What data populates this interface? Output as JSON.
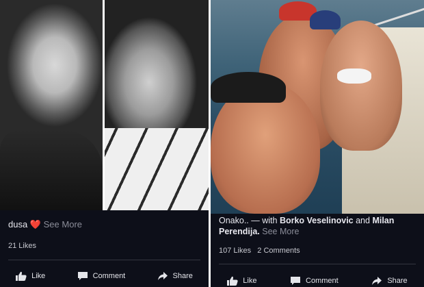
{
  "left_post": {
    "caption_text": "dusa",
    "caption_emoji": "❤️",
    "see_more": "See More",
    "likes": "21 Likes",
    "actions": {
      "like": "Like",
      "comment": "Comment",
      "share": "Share"
    }
  },
  "right_post": {
    "caption_prefix": "Onako.. — with",
    "tag1": "Borko Veselinovic",
    "and": "and",
    "tag2": "Milan Perendija.",
    "see_more": "See More",
    "likes": "107 Likes",
    "comments": "2 Comments",
    "actions": {
      "like": "Like",
      "comment": "Comment",
      "share": "Share"
    }
  },
  "colors": {
    "background": "#0d0f19",
    "text": "#e8e8ef",
    "muted": "#8b8d99",
    "heart": "#e0243a"
  },
  "icons": [
    "thumbs-up-icon",
    "comment-icon",
    "share-icon"
  ]
}
